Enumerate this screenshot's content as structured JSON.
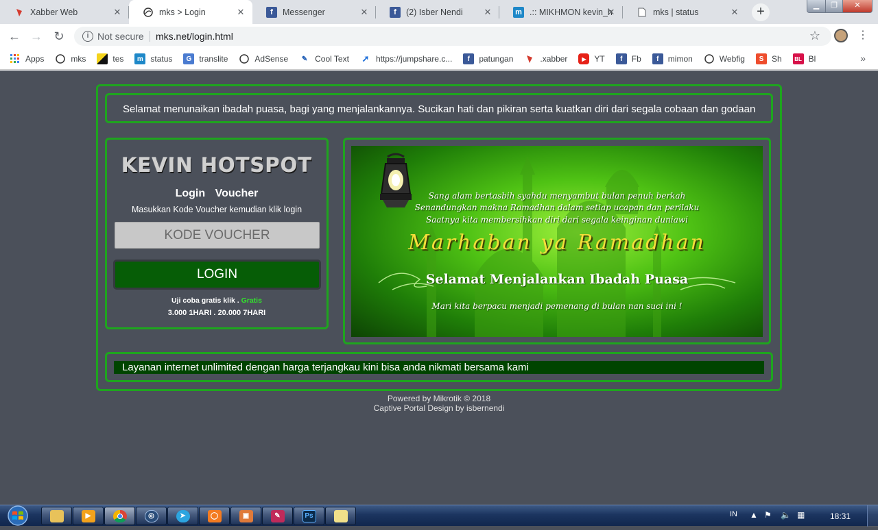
{
  "browser": {
    "tabs": [
      {
        "title": "Xabber Web",
        "icon": "xabber-icon",
        "active": false
      },
      {
        "title": "mks > Login",
        "icon": "mikrotik-icon",
        "active": true
      },
      {
        "title": "Messenger",
        "icon": "facebook-icon",
        "active": false
      },
      {
        "title": "(2) Isber Nendi",
        "icon": "facebook-icon",
        "active": false
      },
      {
        "title": ".:: MIKHMON kevin_h",
        "icon": "mikhmon-icon",
        "active": false
      },
      {
        "title": "mks | status",
        "icon": "page-icon",
        "active": false
      }
    ],
    "new_tab": "+",
    "security_label": "Not secure",
    "url": "mks.net/login.html",
    "bookmarks": [
      {
        "label": "Apps",
        "icon": "apps-icon"
      },
      {
        "label": "mks",
        "icon": "mikrotik-icon"
      },
      {
        "label": "tes",
        "icon": "tes-icon"
      },
      {
        "label": "status",
        "icon": "mikhmon-icon"
      },
      {
        "label": "translite",
        "icon": "translate-icon"
      },
      {
        "label": "AdSense",
        "icon": "mikrotik-icon"
      },
      {
        "label": "Cool Text",
        "icon": "cooltext-icon"
      },
      {
        "label": "https://jumpshare.c...",
        "icon": "jumpshare-icon"
      },
      {
        "label": "patungan",
        "icon": "facebook-icon"
      },
      {
        "label": ".xabber",
        "icon": "xabber-icon"
      },
      {
        "label": "YT",
        "icon": "youtube-icon"
      },
      {
        "label": "Fb",
        "icon": "facebook-icon"
      },
      {
        "label": "mimon",
        "icon": "facebook-icon"
      },
      {
        "label": "Webfig",
        "icon": "mikrotik-icon"
      },
      {
        "label": "Sh",
        "icon": "shopee-icon"
      },
      {
        "label": "Bl",
        "icon": "bukalapak-icon"
      }
    ],
    "bookmarks_more": "»"
  },
  "page": {
    "marquee_top": "Selamat menunaikan ibadah puasa, bagi yang menjalankannya. Sucikan hati dan pikiran serta kuatkan diri dari segala cobaan dan godaan",
    "logo_text": "KEVIN HOTSPOT",
    "login_title": "Login Voucher",
    "instruction": "Masukkan Kode Voucher kemudian klik login",
    "voucher_placeholder": "KODE VOUCHER",
    "login_button": "LOGIN",
    "trial_prefix": "Uji coba gratis klik . ",
    "trial_link": "Gratis",
    "prices": "3.000 1HARI . 20.000 7HARI",
    "banner": {
      "line1": "Sang alam bertasbih syahdu menyambut bulan penuh berkah",
      "line2": "Senandungkan makna Ramadhan dalam setiap ucapan dan perilaku",
      "line3": "Saatnya kita membersihkan diri dari segala keinginan duniawi",
      "headline": "Marhaban ya Ramadhan",
      "subheadline": "Selamat Menjalankan Ibadah Puasa",
      "line4": "Mari kita berpacu menjadi pemenang di bulan nan suci ini !"
    },
    "marquee_bottom": "Layanan internet unlimited dengan harga terjangkau kini bisa anda nikmati bersama kami",
    "footer_line1": "Powered by Mikrotik © 2018",
    "footer_line2": "Captive Portal Design by isbernendi"
  },
  "taskbar": {
    "items": [
      {
        "icon": "explorer-icon"
      },
      {
        "icon": "media-player-icon"
      },
      {
        "icon": "chrome-icon",
        "active": true
      },
      {
        "icon": "winbox-icon"
      },
      {
        "icon": "telegram-icon"
      },
      {
        "icon": "orange-app-icon"
      },
      {
        "icon": "image-app-icon"
      },
      {
        "icon": "editor-icon"
      },
      {
        "icon": "photoshop-icon",
        "label": "Ps"
      },
      {
        "icon": "notepad-icon"
      }
    ],
    "language": "IN",
    "clock": "18:31"
  },
  "colors": {
    "page_bg": "#4b505a",
    "box_border": "#1ea51e",
    "login_button": "#065d06",
    "trial_link": "#32e32c",
    "banner_headline": "#f6de3a"
  }
}
